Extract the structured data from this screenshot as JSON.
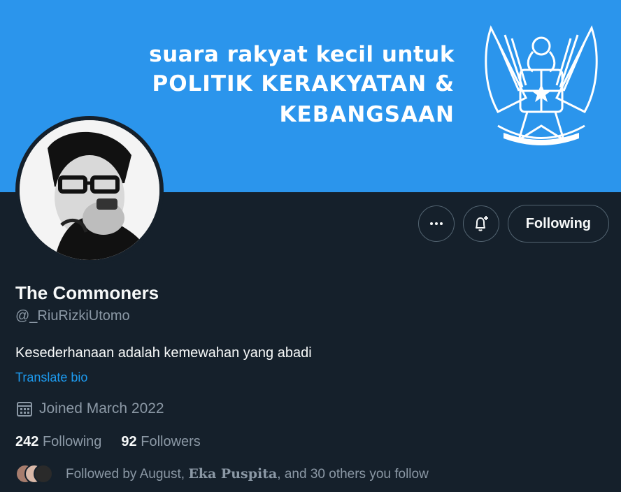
{
  "banner": {
    "line1": "suara rakyat kecil untuk",
    "line2": "POLITIK KERAKYATAN &",
    "line3": "KEBANGSAAN",
    "color": "#2b95ec"
  },
  "profile": {
    "name": "The Commoners",
    "handle": "@_RiuRizkiUtomo",
    "bio": "Kesederhanaan adalah kemewahan yang abadi",
    "translate_label": "Translate bio",
    "joined": "Joined March 2022"
  },
  "actions": {
    "more_icon": "more-horizontal-icon",
    "notify_icon": "bell-plus-icon",
    "following_label": "Following"
  },
  "stats": {
    "following_count": "242",
    "following_label": "Following",
    "followers_count": "92",
    "followers_label": "Followers"
  },
  "followed_by": {
    "prefix": "Followed by August,",
    "name": "Eka Puspita",
    "suffix": ", and 30 others you follow"
  },
  "colors": {
    "background": "#15202b",
    "accent": "#1d9bf0",
    "muted": "#8b98a5"
  }
}
